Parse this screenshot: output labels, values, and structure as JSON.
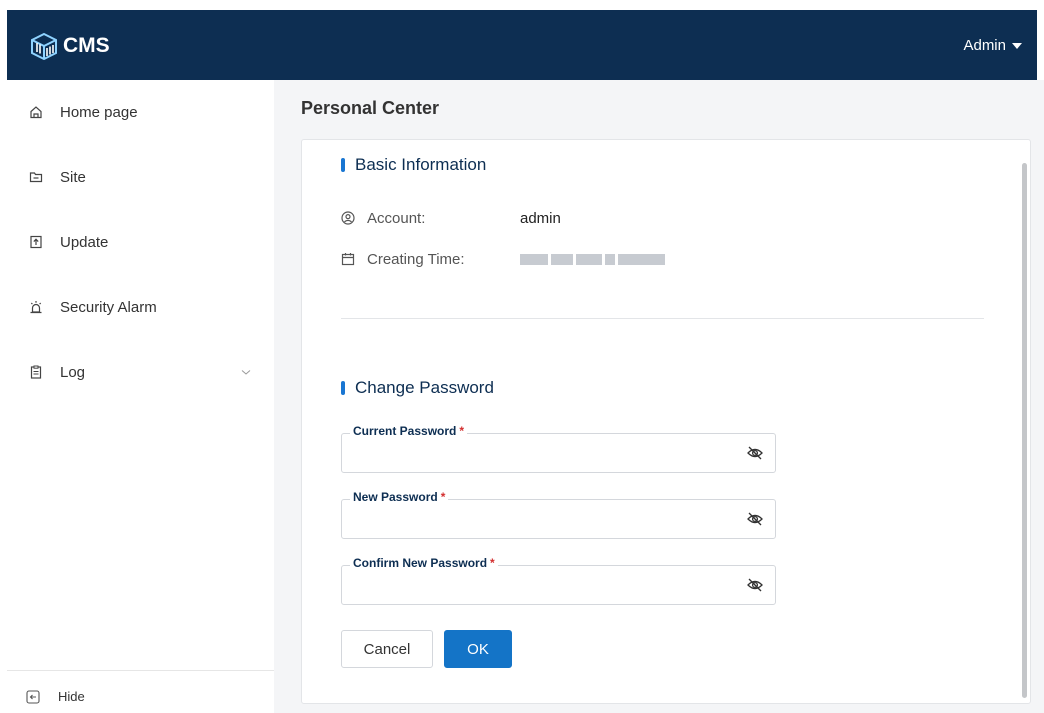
{
  "header": {
    "app_name": "CMS",
    "user_name": "Admin",
    "background_color": "#0d2e52"
  },
  "sidebar": {
    "items": [
      {
        "label": "Home page",
        "icon": "home-icon"
      },
      {
        "label": "Site",
        "icon": "folder-icon"
      },
      {
        "label": "Update",
        "icon": "update-icon"
      },
      {
        "label": "Security Alarm",
        "icon": "alarm-icon"
      },
      {
        "label": "Log",
        "icon": "clipboard-icon",
        "expandable": true
      }
    ],
    "hide_label": "Hide"
  },
  "main": {
    "page_title": "Personal Center",
    "basic_info": {
      "section_title": "Basic Information",
      "account_label": "Account:",
      "account_value": "admin",
      "creating_time_label": "Creating Time:",
      "creating_time_value_redacted": true
    },
    "change_password": {
      "section_title": "Change Password",
      "fields": [
        {
          "label": "Current Password",
          "required_mark": "*",
          "value": ""
        },
        {
          "label": "New Password",
          "required_mark": "*",
          "value": ""
        },
        {
          "label": "Confirm New Password",
          "required_mark": "*",
          "value": ""
        }
      ],
      "cancel_label": "Cancel",
      "ok_label": "OK"
    }
  },
  "colors": {
    "accent": "#1474c7",
    "section_bar": "#1976d2",
    "required": "#d32f2f"
  }
}
